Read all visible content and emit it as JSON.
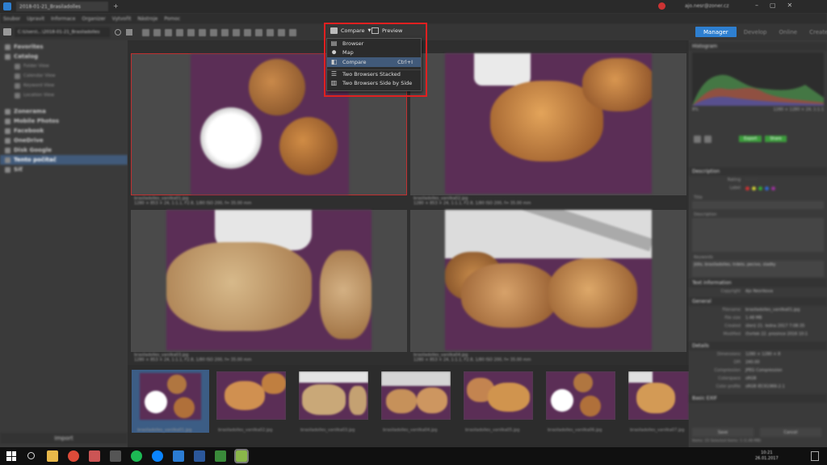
{
  "titlebar": {
    "tab_title": "2018-01-21_Brasiladolles"
  },
  "menubar": {
    "items": [
      "Soubor",
      "Upravit",
      "Informace",
      "Organizer",
      "Vytvořit",
      "Nástroje",
      "Pomoc"
    ]
  },
  "toolbar": {
    "path": "C:\\Users\\...\\2018-01-21_Brasiladolles",
    "mode_tabs": [
      "Manager",
      "Develop",
      "Online",
      "Create"
    ],
    "active_mode": "Manager",
    "compare_label": "Compare",
    "preview_label": "Preview"
  },
  "dropdown": {
    "items": [
      {
        "icon": "browser-icon",
        "label": "Browser",
        "shortcut": ""
      },
      {
        "icon": "map-pin-icon",
        "label": "Map",
        "shortcut": ""
      },
      {
        "icon": "compare-icon",
        "label": "Compare",
        "shortcut": "Ctrl+I"
      },
      {
        "icon": "stacked-icon",
        "label": "Two Browsers Stacked",
        "shortcut": ""
      },
      {
        "icon": "side-by-side-icon",
        "label": "Two Browsers Side by Side",
        "shortcut": ""
      }
    ],
    "selected": "Compare"
  },
  "sidebar": {
    "items": [
      {
        "label": "Favorites",
        "indent": 0
      },
      {
        "label": "Catalog",
        "indent": 0
      },
      {
        "label": "Folder View",
        "indent": 1
      },
      {
        "label": "Calendar View",
        "indent": 1
      },
      {
        "label": "Keyword View",
        "indent": 1
      },
      {
        "label": "Location View",
        "indent": 1
      },
      {
        "label": "Zonerama",
        "indent": 0
      },
      {
        "label": "Mobile Photos",
        "indent": 0
      },
      {
        "label": "Facebook",
        "indent": 0
      },
      {
        "label": "OneDrive",
        "indent": 0
      },
      {
        "label": "Disk Google",
        "indent": 0
      },
      {
        "label": "Tento počítač",
        "indent": 0
      },
      {
        "label": "Síť",
        "indent": 0
      }
    ],
    "selected": "Tento počítač",
    "import_label": "Import"
  },
  "compare": {
    "captions": [
      {
        "name": "brasiladolles_vanilka01.jpg",
        "meta": "1280 × 853 × 24, 1:1.1, F2.8, 1/80 ISO 200, f= 35.00 mm"
      },
      {
        "name": "brasiladolles_vanilka02.jpg",
        "meta": "1280 × 853 × 24, 1:1.1, F2.8, 1/80 ISO 200, f= 35.00 mm"
      },
      {
        "name": "brasiladolles_vanilka03.jpg",
        "meta": "1280 × 853 × 24, 1:1.1, F2.8, 1/80 ISO 200, f= 35.00 mm"
      },
      {
        "name": "brasiladolles_vanilka04.jpg",
        "meta": "1280 × 853 × 24, 1:1.1, F2.8, 1/80 ISO 200, f= 35.00 mm"
      }
    ]
  },
  "filmstrip": {
    "names": [
      "brasiladolles_vanilka01.jpg",
      "brasiladolles_vanilka02.jpg",
      "brasiladolles_vanilka03.jpg",
      "brasiladolles_vanilka04.jpg",
      "brasiladolles_vanilka05.jpg",
      "brasiladolles_vanilka06.jpg",
      "brasiladolles_vanilka07.jpg"
    ]
  },
  "right": {
    "histogram_label": "Histogram",
    "hist_left": "8%",
    "hist_right": "1280 × 1280 × 24, 1:1.1",
    "export_label": "Export",
    "share_label": "Share",
    "description_label": "Description",
    "rating_label": "Rating",
    "label_label": "Label",
    "title_label": "Title",
    "desc_field_label": "Description",
    "keywords_label": "Keywords",
    "keywords_value": "jídlo, brasiladolles, trdelo, pecivo, sladky",
    "text_info_label": "Text information",
    "copyright_label": "Copyright",
    "copyright_value": "Ajo Nesrikova",
    "general_label": "General",
    "general": [
      {
        "k": "Filename",
        "v": "brasiladolles_vanilka01.jpg"
      },
      {
        "k": "File size",
        "v": "1.48 MB"
      },
      {
        "k": "Created",
        "v": "úterý 21. ledna 2017 7:08:35"
      },
      {
        "k": "Modified",
        "v": "čtvrtek 22. prosince 2016 10:1"
      }
    ],
    "details_label": "Details",
    "details": [
      {
        "k": "Dimensions",
        "v": "1280 × 1280 × 8"
      },
      {
        "k": "DPI",
        "v": "240.00"
      },
      {
        "k": "Compression",
        "v": "JPEG Compression"
      },
      {
        "k": "Colorspace",
        "v": "sRGB"
      },
      {
        "k": "Color profile",
        "v": "sRGB IEC61966-2.1"
      }
    ],
    "basic_exif_label": "Basic EXIF",
    "save_label": "Save",
    "cancel_label": "Cancel",
    "status": "Items: 15   Selected items: 1 (1.48 MB)"
  },
  "taskbar": {
    "time": "10:21",
    "date": "26.01.2017"
  },
  "colors": {
    "accent": "#2e7fd0",
    "selection": "#415a7a",
    "highlight": "#e02020",
    "purple": "#5a2f55"
  }
}
